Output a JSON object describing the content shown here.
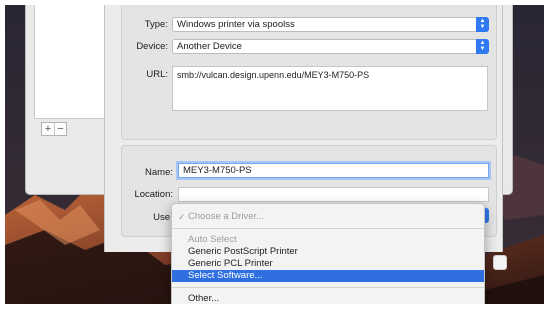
{
  "printer_sheet": {
    "type_label": "Type:",
    "type_value": "Windows printer via spoolss",
    "device_label": "Device:",
    "device_value": "Another Device",
    "url_label": "URL:",
    "url_value": "smb://vulcan.design.upenn.edu/MEY3-M750-PS",
    "name_label": "Name:",
    "name_value": "MEY3-M750-PS",
    "location_label": "Location:",
    "location_value": "",
    "use_label": "Use"
  },
  "back_window": {
    "add_label": "+",
    "remove_label": "−"
  },
  "driver_menu": {
    "choose_driver": "Choose a Driver...",
    "auto_select": "Auto Select",
    "generic_postscript": "Generic PostScript Printer",
    "generic_pcl": "Generic PCL Printer",
    "select_software": "Select Software...",
    "other": "Other..."
  },
  "icons": {
    "check": "checkmark-icon",
    "popup_arrows": "up-down-arrows-icon"
  },
  "colors": {
    "accent": "#2f7af2",
    "menu_highlight": "#2f6fe0",
    "focus_ring": "#a8c6f4"
  }
}
